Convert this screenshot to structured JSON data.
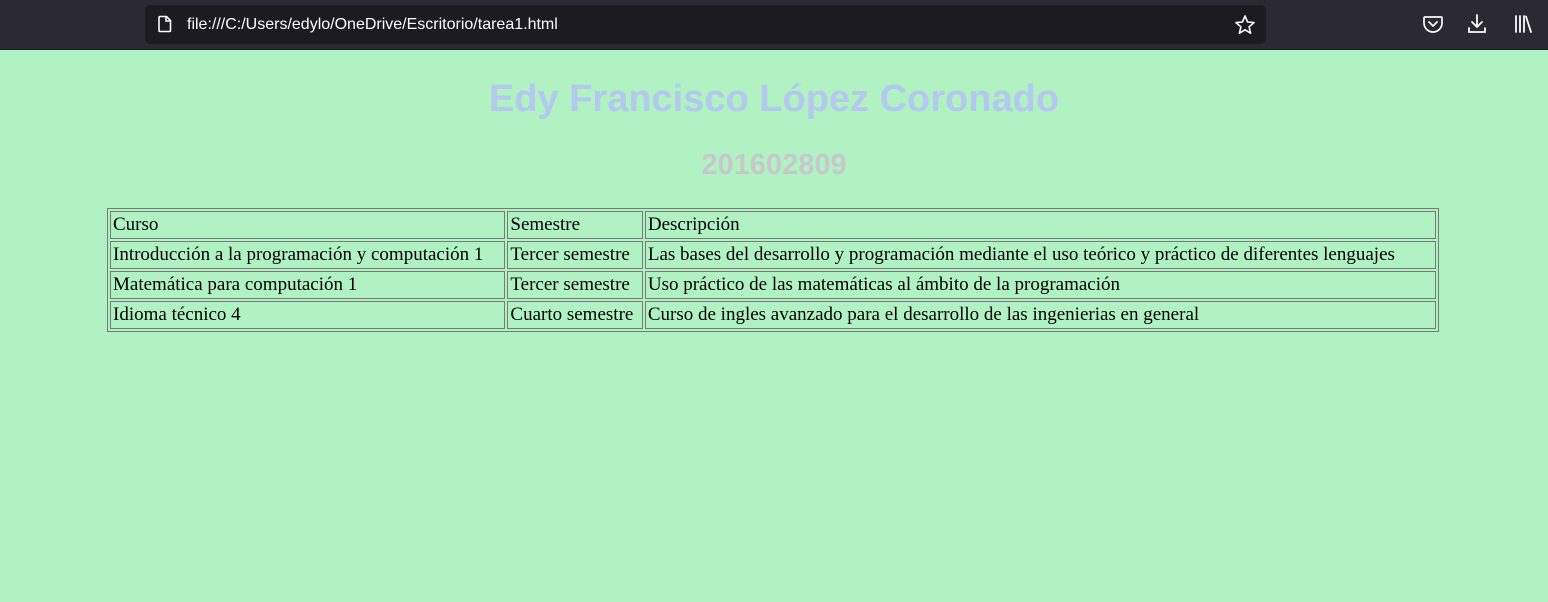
{
  "browser": {
    "url": "file:///C:/Users/edylo/OneDrive/Escritorio/tarea1.html"
  },
  "page": {
    "heading": "Edy Francisco López Coronado",
    "subheading": "201602809"
  },
  "table": {
    "headers": [
      "Curso",
      "Semestre",
      "Descripción"
    ],
    "rows": [
      [
        "Introducción a la programación y computación 1",
        "Tercer semestre",
        "Las bases del desarrollo y programación mediante el uso teórico y práctico de diferentes lenguajes"
      ],
      [
        "Matemática para computación 1",
        "Tercer semestre",
        "Uso práctico de las matemáticas al ámbito de la programación"
      ],
      [
        "Idioma técnico 4",
        "Cuarto semestre",
        "Curso de ingles avanzado para el desarrollo de las ingenierias en general"
      ]
    ]
  },
  "colors": {
    "page_background": "#b0f2c2",
    "heading": "#b5c8f0",
    "subheading": "#c8c8cc"
  }
}
